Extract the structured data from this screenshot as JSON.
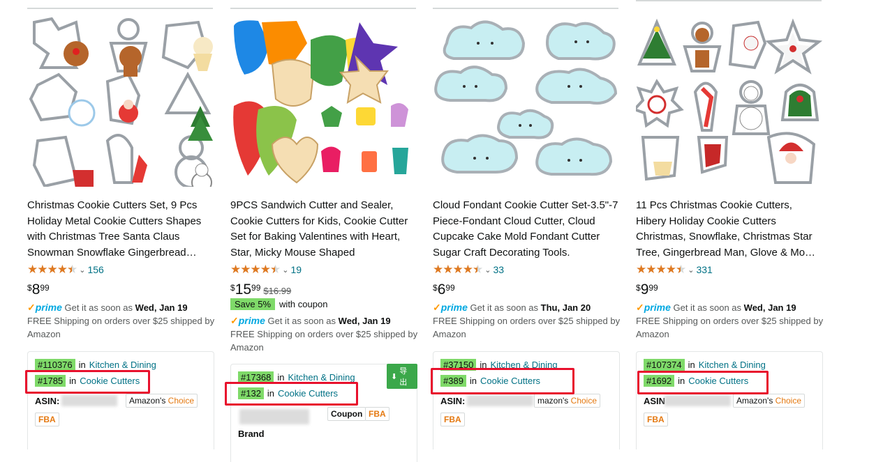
{
  "products": [
    {
      "title": "Christmas Cookie Cutters Set, 9 Pcs Holiday Metal Cookie Cutters Shapes with Christmas Tree Santa Claus Snowman Snowflake Gingerbread…",
      "rating": 4.5,
      "review_count": "156",
      "price": {
        "symbol": "$",
        "whole": "8",
        "fraction": "99"
      },
      "prime_label": "prime",
      "delivery_prefix": "Get it as soon as",
      "delivery_date": "Wed, Jan 19",
      "shipping": "FREE Shipping on orders over $25 shipped by Amazon",
      "rank1_num": "#110376",
      "rank1_in": "in",
      "rank1_cat": "Kitchen & Dining",
      "rank2_num": "#1785",
      "rank2_in": "in",
      "rank2_cat": "Cookie Cutters",
      "asin_label": "ASIN:",
      "choice_a": "Amazon's",
      "choice_b": "Choice",
      "fba": "FBA"
    },
    {
      "title": "9PCS Sandwich Cutter and Sealer, Cookie Cutters for Kids, Cookie Cutter Set for Baking Valentines with Heart, Star, Micky Mouse Shaped",
      "rating": 4.5,
      "review_count": "19",
      "price": {
        "symbol": "$",
        "whole": "15",
        "fraction": "99",
        "old": "$16.99"
      },
      "coupon_badge": "Save 5%",
      "coupon_text": "with coupon",
      "prime_label": "prime",
      "delivery_prefix": "Get it as soon as",
      "delivery_date": "Wed, Jan 19",
      "shipping": "FREE Shipping on orders over $25 shipped by Amazon",
      "export_label": "导出",
      "rank1_num": "#17368",
      "rank1_in": "in",
      "rank1_cat": "Kitchen & Dining",
      "rank2_num": "#132",
      "rank2_in": "in",
      "rank2_cat": "Cookie Cutters",
      "coupon_tag": "Coupon",
      "fba": "FBA",
      "brand_partial": "Brand"
    },
    {
      "title": "Cloud Fondant Cookie Cutter Set-3.5\"-7 Piece-Fondant Cloud Cutter, Cloud Cupcake Cake Mold Fondant Cutter Sugar Craft Decorating Tools.",
      "rating": 4.5,
      "review_count": "33",
      "price": {
        "symbol": "$",
        "whole": "6",
        "fraction": "99"
      },
      "prime_label": "prime",
      "delivery_prefix": "Get it as soon as",
      "delivery_date": "Thu, Jan 20",
      "shipping": "FREE Shipping on orders over $25 shipped by Amazon",
      "rank1_num": "#37150",
      "rank1_in": "in",
      "rank1_cat": "Kitchen & Dining",
      "rank2_num": "#389",
      "rank2_in": "in",
      "rank2_cat": "Cookie Cutters",
      "asin_label": "ASIN:",
      "choice_a": "mazon's",
      "choice_b": "Choice",
      "fba": "FBA"
    },
    {
      "title": "11 Pcs Christmas Cookie Cutters, Hibery Holiday Cookie Cutters Christmas, Snowflake, Christmas Star Tree, Gingerbread Man, Glove & Mo…",
      "rating": 4.5,
      "review_count": "331",
      "price": {
        "symbol": "$",
        "whole": "9",
        "fraction": "99"
      },
      "prime_label": "prime",
      "delivery_prefix": "Get it as soon as",
      "delivery_date": "Wed, Jan 19",
      "shipping": "FREE Shipping on orders over $25 shipped by Amazon",
      "rank1_num": "#107374",
      "rank1_in": "in",
      "rank1_cat": "Kitchen & Dining",
      "rank2_num": "#1692",
      "rank2_in": "in",
      "rank2_cat": "Cookie Cutters",
      "asin_label": "ASIN",
      "choice_a": "Amazon's",
      "choice_b": "Choice",
      "fba": "FBA"
    }
  ],
  "colors": {
    "link": "#007185",
    "star": "#de7921",
    "prime": "#00a8e1",
    "rank_badge": "#7fda69",
    "highlight": "#e8112d",
    "export": "#3ba84a"
  },
  "icons": [
    "star-rating-icon",
    "chevron-down-icon",
    "prime-check-icon",
    "download-icon"
  ]
}
